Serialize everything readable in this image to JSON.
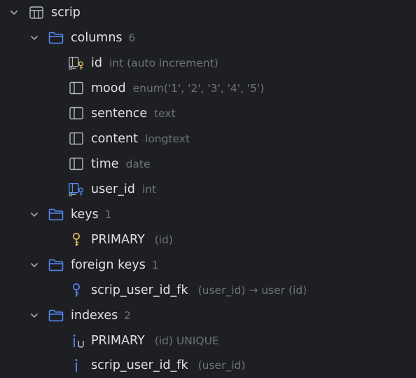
{
  "colors": {
    "background": "#1e1f22",
    "text": "#dfe1e5",
    "hint": "#6f737a",
    "folder": "#548af7",
    "key": "#f2c55c",
    "blue_icon": "#548af7"
  },
  "tree": {
    "table": {
      "name": "scrip",
      "icon": "table-icon"
    },
    "columns": {
      "label": "columns",
      "count": "6",
      "items": [
        {
          "name": "id",
          "type": "int (auto increment)",
          "icon": "primary-key-column-icon"
        },
        {
          "name": "mood",
          "type": "enum('1', '2', '3', '4', '5')",
          "icon": "column-icon"
        },
        {
          "name": "sentence",
          "type": "text",
          "icon": "column-icon"
        },
        {
          "name": "content",
          "type": "longtext",
          "icon": "column-icon"
        },
        {
          "name": "time",
          "type": "date",
          "icon": "column-icon"
        },
        {
          "name": "user_id",
          "type": "int",
          "icon": "foreign-key-column-icon"
        }
      ]
    },
    "keys": {
      "label": "keys",
      "count": "1",
      "items": [
        {
          "name": "PRIMARY",
          "detail": "(id)",
          "icon": "key-icon"
        }
      ]
    },
    "foreign_keys": {
      "label": "foreign keys",
      "count": "1",
      "items": [
        {
          "name": "scrip_user_id_fk",
          "detail": "(user_id) → user (id)",
          "icon": "foreign-key-icon"
        }
      ]
    },
    "indexes": {
      "label": "indexes",
      "count": "2",
      "items": [
        {
          "name": "PRIMARY",
          "detail": "(id) UNIQUE",
          "icon": "unique-index-icon"
        },
        {
          "name": "scrip_user_id_fk",
          "detail": "(user_id)",
          "icon": "index-icon"
        }
      ]
    }
  }
}
